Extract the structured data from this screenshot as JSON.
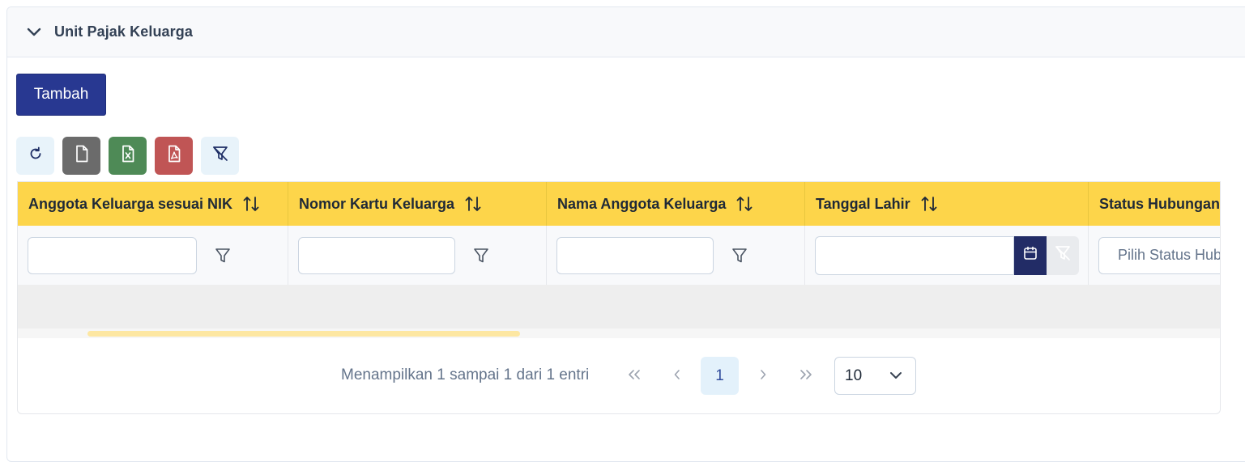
{
  "panel": {
    "title": "Unit Pajak Keluarga"
  },
  "actions": {
    "add_label": "Tambah"
  },
  "toolbar": {
    "items": [
      {
        "name": "refresh-icon",
        "color": "#e8f3fa"
      },
      {
        "name": "file-icon",
        "color": "#6b6b6b"
      },
      {
        "name": "file-excel-icon",
        "color": "#4e8a56"
      },
      {
        "name": "file-pdf-icon",
        "color": "#c05555"
      },
      {
        "name": "filter-clear-icon",
        "color": "#e8f3fa"
      }
    ]
  },
  "table": {
    "columns": [
      {
        "label": "Anggota Keluarga sesuai NIK"
      },
      {
        "label": "Nomor Kartu Keluarga"
      },
      {
        "label": "Nama Anggota Keluarga"
      },
      {
        "label": "Tanggal Lahir"
      },
      {
        "label": "Status Hubungan"
      }
    ],
    "filters": {
      "status_placeholder": "Pilih Status Hubungan"
    },
    "header_color": "#fdd54a"
  },
  "pagination": {
    "summary": "Menampilkan 1 sampai 1 dari 1 entri",
    "current_page": "1",
    "rows_per_page": "10"
  },
  "colors": {
    "primary": "#283891",
    "calendar_button": "#222c66"
  }
}
